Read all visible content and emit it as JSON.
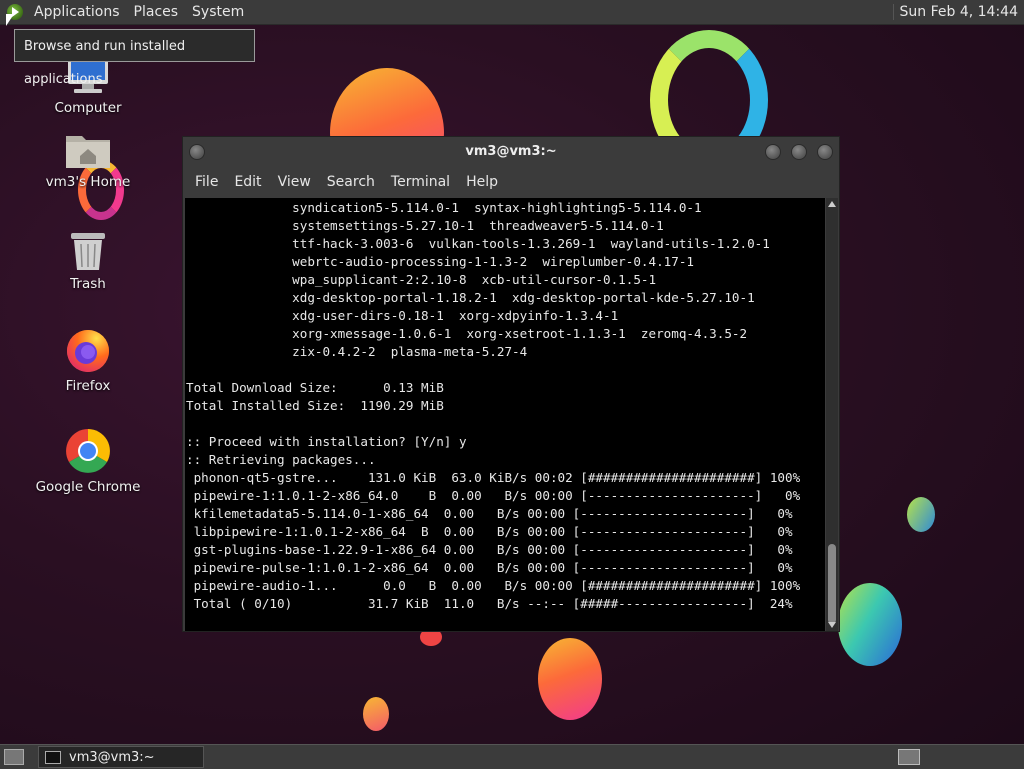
{
  "top_panel": {
    "menus": [
      "Applications",
      "Places",
      "System"
    ],
    "clock": "Sun Feb  4, 14:44"
  },
  "tooltip": "Browse and run installed applications",
  "desktop_icons": [
    {
      "label": "Computer",
      "icon": "computer-icon"
    },
    {
      "label": "vm3's Home",
      "icon": "home-folder-icon"
    },
    {
      "label": "Trash",
      "icon": "trash-icon"
    },
    {
      "label": "Firefox",
      "icon": "firefox-icon"
    },
    {
      "label": "Google Chrome",
      "icon": "chrome-icon"
    }
  ],
  "terminal": {
    "title": "vm3@vm3:~",
    "menu": [
      "File",
      "Edit",
      "View",
      "Search",
      "Terminal",
      "Help"
    ],
    "lines": [
      "              syndication5-5.114.0-1  syntax-highlighting5-5.114.0-1",
      "              systemsettings-5.27.10-1  threadweaver5-5.114.0-1",
      "              ttf-hack-3.003-6  vulkan-tools-1.3.269-1  wayland-utils-1.2.0-1",
      "              webrtc-audio-processing-1-1.3-2  wireplumber-0.4.17-1",
      "              wpa_supplicant-2:2.10-8  xcb-util-cursor-0.1.5-1",
      "              xdg-desktop-portal-1.18.2-1  xdg-desktop-portal-kde-5.27.10-1",
      "              xdg-user-dirs-0.18-1  xorg-xdpyinfo-1.3.4-1",
      "              xorg-xmessage-1.0.6-1  xorg-xsetroot-1.1.3-1  zeromq-4.3.5-2",
      "              zix-0.4.2-2  plasma-meta-5.27-4",
      "",
      "Total Download Size:      0.13 MiB",
      "Total Installed Size:  1190.29 MiB",
      "",
      ":: Proceed with installation? [Y/n] y",
      ":: Retrieving packages...",
      " phonon-qt5-gstre...    131.0 KiB  63.0 KiB/s 00:02 [######################] 100%",
      " pipewire-1:1.0.1-2-x86_64.0    B  0.00   B/s 00:00 [----------------------]   0%",
      " kfilemetadata5-5.114.0-1-x86_64  0.00   B/s 00:00 [----------------------]   0%",
      " libpipewire-1:1.0.1-2-x86_64  B  0.00   B/s 00:00 [----------------------]   0%",
      " gst-plugins-base-1.22.9-1-x86_64 0.00   B/s 00:00 [----------------------]   0%",
      " pipewire-pulse-1:1.0.1-2-x86_64  0.00   B/s 00:00 [----------------------]   0%",
      " pipewire-audio-1...      0.0   B  0.00   B/s 00:00 [######################] 100%",
      " Total ( 0/10)          31.7 KiB  11.0   B/s --:-- [#####-----------------]  24%"
    ]
  },
  "taskbar": {
    "window_label": "vm3@vm3:~"
  }
}
